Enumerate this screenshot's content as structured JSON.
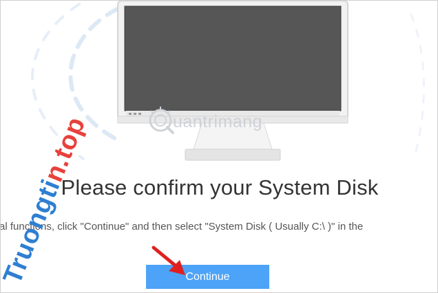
{
  "dialog": {
    "headline": "Please confirm your System Disk",
    "instruction": "al functions, click \"Continue\" and then select \"System Disk ( Usually C:\\ )\" in the",
    "continue_label": "Continue"
  },
  "watermarks": {
    "vertical_text_part1": "Truongti",
    "vertical_text_part2": "n.top",
    "logo_text": "uantrimang"
  },
  "colors": {
    "button_bg": "#4da3f7",
    "screen": "#555555",
    "monitor_body": "#f1f1f1",
    "watermark_blue": "#2f7fd1",
    "watermark_red": "#e8413b",
    "arrow": "#e02020"
  },
  "icons": {
    "monitor": "monitor-illustration",
    "arrow": "red-pointer-arrow",
    "logo": "quantrimang-logo-icon"
  }
}
